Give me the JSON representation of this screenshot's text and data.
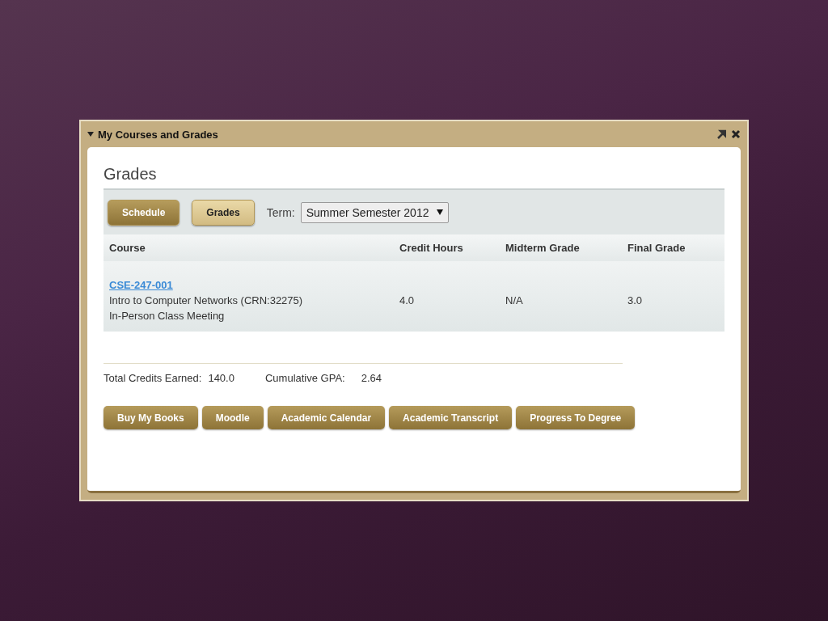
{
  "portlet": {
    "title": "My Courses and Grades",
    "expanded": true
  },
  "heading": "Grades",
  "views": [
    {
      "label": "Schedule",
      "selected": false
    },
    {
      "label": "Grades",
      "selected": true
    }
  ],
  "term": {
    "label": "Term:",
    "value": "Summer Semester 2012"
  },
  "table": {
    "columns": [
      "Course",
      "Credit Hours",
      "Midterm Grade",
      "Final Grade"
    ],
    "rows": [
      {
        "code": "CSE-247-001",
        "title": "Intro to Computer Networks (CRN:32275)",
        "meeting": "In-Person Class Meeting",
        "credit_hours": "4.0",
        "midterm": "N/A",
        "final": "3.0"
      }
    ]
  },
  "totals": [
    {
      "label": "Total Credits Earned:",
      "value": "140.0"
    },
    {
      "label": "Cumulative GPA:",
      "value": "2.64"
    }
  ],
  "links": [
    "Buy My Books",
    "Moodle",
    "Academic Calendar",
    "Academic Transcript",
    "Progress To Degree"
  ]
}
